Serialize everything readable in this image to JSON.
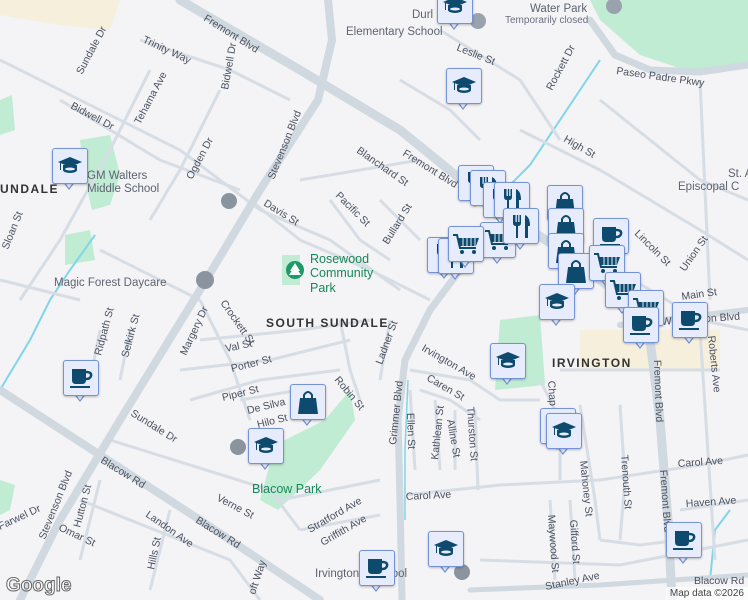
{
  "map": {
    "area_labels": [
      "SOUTH SUNDALE",
      "IRVINGTON",
      "UNDALE"
    ],
    "parks": [
      "Rosewood Community Park",
      "Blacow Park"
    ],
    "parks_lines": {
      "rosewood": [
        "Rosewood",
        "Community",
        "Park"
      ]
    },
    "places": {
      "water_park": "Water Park",
      "water_park_status": "Temporarily closed",
      "durham_school_1": "Durl",
      "durham_school_2": "Elementary School",
      "walters_1": "GM Walters",
      "walters_2": "Middle School",
      "magic_forest": "Magic Forest Daycare",
      "episcopal_1": "St. A",
      "episcopal_2": "Episcopal C",
      "irvington_school": "Irvington    h School"
    },
    "streets": {
      "fremont_blvd": "Fremont Blvd",
      "stevenson_blvd": "Stevenson Blvd",
      "blacow_rd": "Blacow Rd",
      "grimmer_blvd": "Grimmer Blvd",
      "paseo_padre": "Paseo Padre Pkwy",
      "sundale_dr": "Sundale Dr",
      "trinity_way": "Trinity Way",
      "bidwell_dr": "Bidwell Dr",
      "tehama_ave": "Tehama Ave",
      "ogden_dr": "Ogden Dr",
      "davis_st": "Davis St",
      "pacific_st": "Pacific St",
      "blanchard_st": "Blanchard St",
      "bullard_st": "Bullard St",
      "leslie_st": "Leslie St",
      "rockett_dr": "Rockett Dr",
      "high_st": "High St",
      "lincoln_st": "Lincoln St",
      "union_st": "Union St",
      "main_st": "Main St",
      "washington_blvd": "Washington Blvd",
      "roberts_ave": "Roberts Ave",
      "sloan_st": "Sloan St",
      "ridpath_st": "Ridpath St",
      "selkirk_st": "Selkirk St",
      "margery_dr": "Margery Dr",
      "crockett_st": "Crockett St",
      "val_st": "Val St",
      "porter_st": "Porter St",
      "piper_st": "Piper St",
      "de_silva": "De Silva",
      "hilo_st": "Hilo St",
      "robin_st": "Robin St",
      "ladner_st": "Ladner St",
      "irvington_ave": "Irvington Ave",
      "caren_st": "Caren St",
      "ellen_st": "Ellen St",
      "kathlean_st": "Kathlean St",
      "alline_st": "Alline St",
      "thurston_st": "Thurston St",
      "chapel": "Chap",
      "mahoney_st": "Mahoney St",
      "trenouth_st": "Trenouth St",
      "carol_ave": "Carol Ave",
      "haven_ave": "Haven Ave",
      "maywood_st": "Maywood St",
      "gifford_st": "Gifford St",
      "stanley_ave": "Stanley Ave",
      "verne_st": "Verne St",
      "stratford_ave": "Stratford Ave",
      "griffith_ave": "Griffith Ave",
      "landon_ave": "Landon Ave",
      "hutton_st": "Hutton St",
      "omar_st": "Omar St",
      "farwell_dr": "Farwel Dr",
      "hills_st": "Hills St",
      "croft_way": "oft Way"
    },
    "attribution": "Map data ©2026",
    "logo": "Google"
  },
  "markers": [
    {
      "type": "school"
    },
    {
      "type": "school"
    },
    {
      "type": "school"
    },
    {
      "type": "coffee"
    },
    {
      "type": "shopping"
    },
    {
      "type": "school"
    },
    {
      "type": "school"
    },
    {
      "type": "restaurant"
    },
    {
      "type": "restaurant"
    },
    {
      "type": "restaurant"
    },
    {
      "type": "restaurant"
    },
    {
      "type": "grocery"
    },
    {
      "type": "restaurant"
    },
    {
      "type": "restaurant"
    },
    {
      "type": "restaurant"
    },
    {
      "type": "grocery"
    },
    {
      "type": "shopping"
    },
    {
      "type": "shopping"
    },
    {
      "type": "shopping"
    },
    {
      "type": "shopping"
    },
    {
      "type": "coffee"
    },
    {
      "type": "grocery"
    },
    {
      "type": "grocery"
    },
    {
      "type": "grocery"
    },
    {
      "type": "coffee"
    },
    {
      "type": "coffee"
    },
    {
      "type": "school"
    },
    {
      "type": "school"
    },
    {
      "type": "school"
    },
    {
      "type": "coffee"
    },
    {
      "type": "school"
    },
    {
      "type": "coffee"
    }
  ],
  "colors": {
    "marker_icon": "#0d4a6e",
    "marker_bg": "#e6ecfb",
    "park": "#c0ecd4",
    "road": "#d3dbe3",
    "water": "#7fd6e8"
  }
}
